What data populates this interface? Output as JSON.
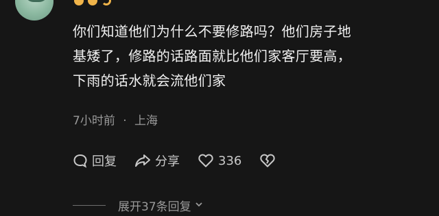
{
  "comment": {
    "lines": [
      "你们知道他们为什么不要修路吗？他们房子地",
      "基矮了，修路的话路面就比他们家客厅要高，",
      "下雨的话水就会流他们家"
    ]
  },
  "meta": {
    "time": "7小时前",
    "separator": "·",
    "location": "上海"
  },
  "actions": {
    "reply_label": "回复",
    "share_label": "分享",
    "like_count": "336"
  },
  "expand": {
    "label": "展开37条回复"
  },
  "icons": {
    "reply": "reply-bubble-icon",
    "share": "share-arrow-icon",
    "like": "heart-outline-icon",
    "dislike": "broken-heart-icon",
    "expand": "chevron-down-icon"
  },
  "colors": {
    "background": "#161616",
    "text_primary": "#f0f0f0",
    "text_secondary": "#9a9a9a",
    "badge": "#f0b44a"
  }
}
